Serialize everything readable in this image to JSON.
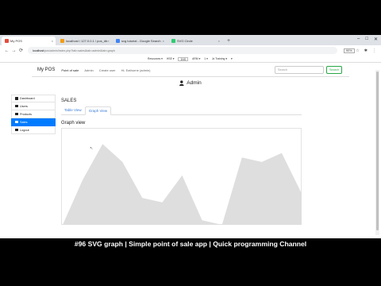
{
  "browser": {
    "tabs": [
      {
        "label": "My POS",
        "favicon_color": "#e74c3c",
        "active": true
      },
      {
        "label": "localhost / 127.0.0.1 / pos_db",
        "favicon_color": "#f39c12",
        "active": false
      },
      {
        "label": "svg tutorial - Google Search",
        "favicon_color": "#4285f4",
        "active": false
      },
      {
        "label": "SVG Circle",
        "favicon_color": "#2ecc71",
        "active": false
      }
    ],
    "new_tab_label": "+",
    "address": {
      "host": "localhost",
      "path": "/pos/admin/index.php?tab=sales&tab=admin&tab=graph"
    },
    "zoom": "90%",
    "ext_bar": [
      "Resources ▾",
      "HSE ▾",
      "1NS",
      "ARM ▾",
      "1 ▾",
      "Jo Training ▾",
      "▾"
    ]
  },
  "app": {
    "brand": "My POS",
    "nav": [
      "Point of sale",
      "Admin",
      "Create user",
      "Hi, Eathorne (admin)"
    ],
    "search_placeholder": "Search",
    "search_button": "Search",
    "admin_title": "Admin",
    "sidebar": [
      {
        "label": "Dashboard",
        "active": false
      },
      {
        "label": "Users",
        "active": false
      },
      {
        "label": "Products",
        "active": false
      },
      {
        "label": "Sales",
        "active": true
      },
      {
        "label": "Logout",
        "active": false
      }
    ],
    "section_title": "SALES",
    "tabs": [
      {
        "label": "Table View",
        "active": false
      },
      {
        "label": "Graph View",
        "active": true
      }
    ],
    "graph_title": "Graph view"
  },
  "chart_data": {
    "type": "area",
    "title": "Graph view",
    "x": [
      0,
      1,
      2,
      3,
      4,
      5,
      6,
      7,
      8,
      9,
      10,
      11
    ],
    "values": [
      0,
      10,
      18,
      14,
      6,
      5,
      11,
      1,
      0,
      15,
      14,
      16,
      7
    ],
    "ylim": [
      0,
      20
    ],
    "grid": false,
    "fill_color": "#dedede"
  },
  "caption": "#96 SVG graph | Simple point of sale app | Quick programming Channel"
}
